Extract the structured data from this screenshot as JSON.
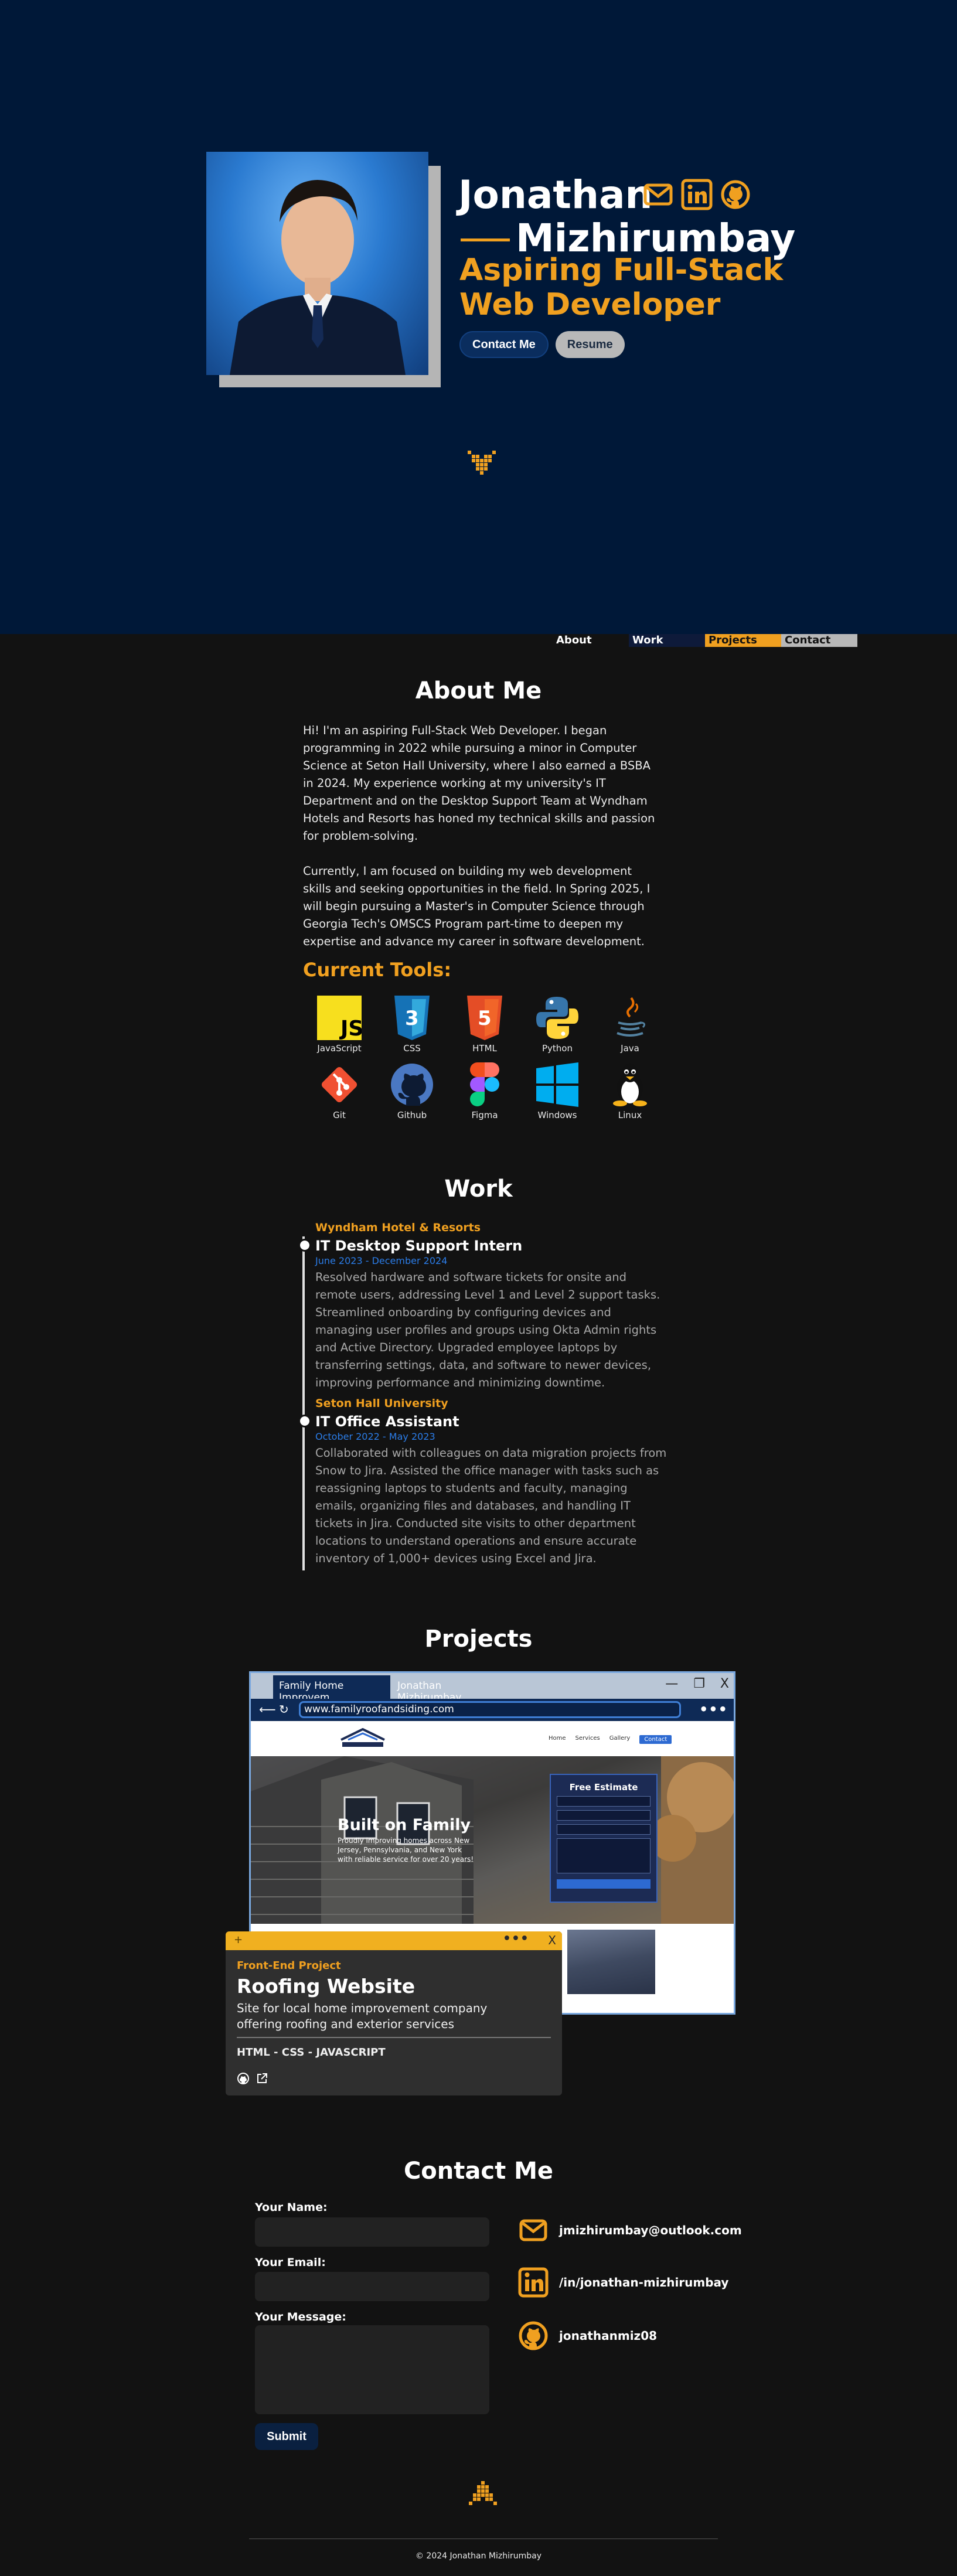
{
  "hero": {
    "name_first": "Jonathan",
    "name_last": "Mizhirumbay",
    "role_line1": "Aspiring Full-Stack",
    "role_line2": "Web Developer",
    "contact_button": "Contact Me",
    "resume_button": "Resume",
    "icons": [
      "mail-icon",
      "linkedin-icon",
      "github-icon",
      "chevron-down-logo-icon"
    ],
    "accent_color": "#f0a020",
    "background_color": "#001838"
  },
  "nav": {
    "items": [
      "About",
      "Work",
      "Projects",
      "Contact"
    ]
  },
  "about": {
    "title": "About Me",
    "paragraph1": "Hi! I'm an aspiring Full-Stack Web Developer. I began programming in 2022 while pursuing a minor in Computer Science at Seton Hall University, where I also earned a BSBA in 2024. My experience working at my university's IT Department and on the Desktop Support Team at Wyndham Hotels and Resorts has honed my technical skills and passion for problem-solving.",
    "paragraph2": "Currently, I am focused on building my web development skills and seeking opportunities in the field. In Spring 2025, I will begin pursuing a Master's in Computer Science through Georgia Tech's OMSCS Program part-time to deepen my expertise and advance my career in software development.",
    "tools_title": "Current Tools:",
    "tools": [
      {
        "label": "JavaScript",
        "icon": "javascript-icon"
      },
      {
        "label": "CSS",
        "icon": "css-icon"
      },
      {
        "label": "HTML",
        "icon": "html-icon"
      },
      {
        "label": "Python",
        "icon": "python-icon"
      },
      {
        "label": "Java",
        "icon": "java-icon"
      },
      {
        "label": "Git",
        "icon": "git-icon"
      },
      {
        "label": "Github",
        "icon": "github-icon"
      },
      {
        "label": "Figma",
        "icon": "figma-icon"
      },
      {
        "label": "Windows",
        "icon": "windows-icon"
      },
      {
        "label": "Linux",
        "icon": "linux-icon"
      }
    ]
  },
  "work": {
    "title": "Work",
    "jobs": [
      {
        "company": "Wyndham Hotel & Resorts",
        "title": "IT Desktop Support Intern",
        "dates": "June 2023 - December 2024",
        "description": "Resolved hardware and software tickets for onsite and remote users, addressing Level 1 and Level 2 support tasks. Streamlined onboarding by configuring devices and managing user profiles and groups using Okta Admin rights and Active Directory. Upgraded employee laptops by transferring settings, data, and software to newer devices, improving performance and minimizing downtime."
      },
      {
        "company": "Seton Hall University",
        "title": "IT Office Assistant",
        "dates": "October 2022 - May 2023",
        "description": "Collaborated with colleagues on data migration projects from Snow to Jira. Assisted the office manager with tasks such as reassigning laptops to students and faculty, managing emails, organizing files and databases, and handling IT tickets in Jira. Conducted site visits to other department locations to understand operations and ensure accurate inventory of 1,000+ devices using Excel and Jira."
      }
    ]
  },
  "projects": {
    "title": "Projects",
    "browser": {
      "tab_active": "Family Home Improvem",
      "tab_inactive": "Jonathan Mizhirumbay",
      "url": "www.familyroofandsiding.com",
      "win_min": "—",
      "win_max": "❐",
      "win_close": "X",
      "site_nav": [
        "Home",
        "Services",
        "Gallery",
        "Contact"
      ],
      "site_hero_title": "Built on Family",
      "site_hero_sub": "Proudly improving homes across New Jersey, Pennsylvania, and New York with reliable service for over 20 years!",
      "estimate_title": "Free Estimate"
    },
    "card": {
      "bar_plus": "+",
      "bar_dots": "•••",
      "bar_close": "X",
      "tag": "Front-End Project",
      "name": "Roofing Website",
      "description": "Site for local home improvement company offering roofing and exterior services",
      "tech": "HTML - CSS - JAVASCRIPT"
    }
  },
  "contact": {
    "title": "Contact Me",
    "name_label": "Your Name:",
    "email_label": "Your Email:",
    "message_label": "Your Message:",
    "submit": "Submit",
    "email": "jmizhirumbay@outlook.com",
    "linkedin": "/in/jonathan-mizhirumbay",
    "github": "jonathanmiz08"
  },
  "footer": {
    "copyright": "© 2024 Jonathan Mizhirumbay"
  }
}
